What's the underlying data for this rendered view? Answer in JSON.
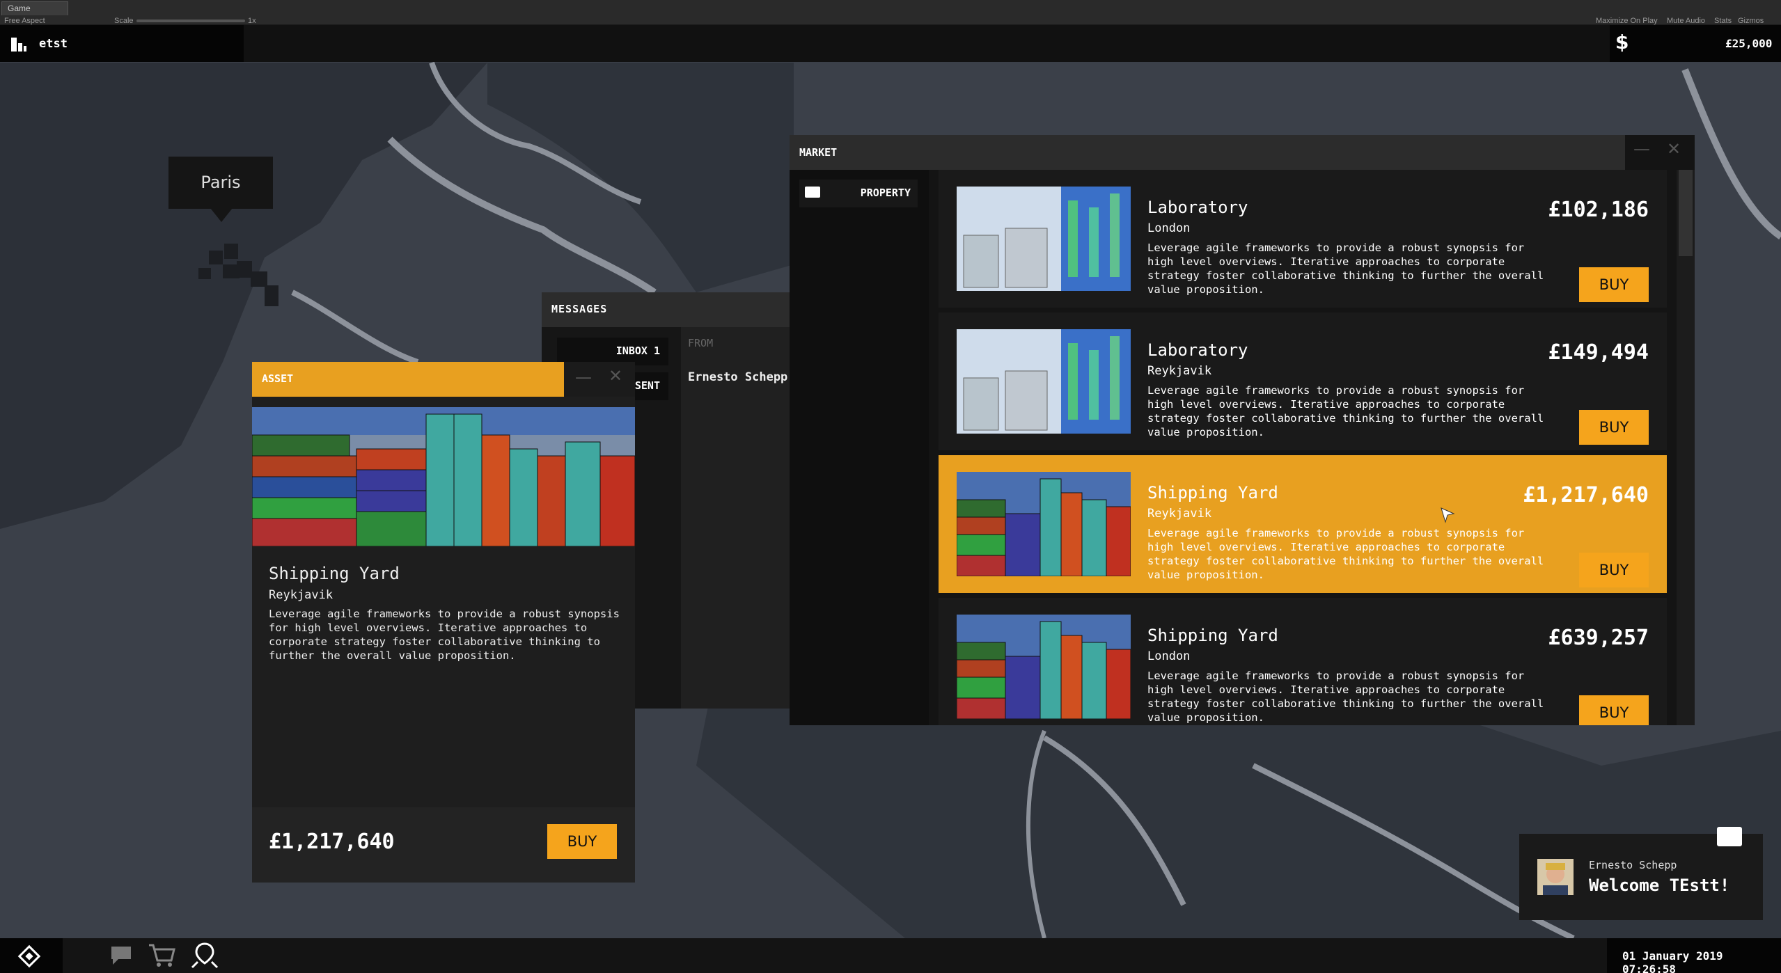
{
  "unity": {
    "tab": "Game",
    "aspect": "Free Aspect",
    "scale_label": "Scale",
    "scale_value": "1x",
    "options": [
      "Maximize On Play",
      "Mute Audio",
      "Stats",
      "Gizmos"
    ]
  },
  "topbar": {
    "company_icon": "building-icon",
    "company_name": "etst",
    "money_icon": "dollar-icon",
    "money": "£25,000"
  },
  "map": {
    "city_label": "Paris"
  },
  "messages": {
    "title": "MESSAGES",
    "inbox_label": "INBOX 1",
    "sent_label": "SENT",
    "from_header": "FROM",
    "rows": [
      {
        "from": "Ernesto Schepp"
      }
    ]
  },
  "asset": {
    "title": "ASSET",
    "name": "Shipping Yard",
    "location": "Reykjavik",
    "description": "Leverage agile frameworks to provide a robust synopsis for high level overviews. Iterative approaches to corporate strategy foster collaborative thinking to further the overall value proposition.",
    "price": "£1,217,640",
    "buy": "BUY"
  },
  "market": {
    "title": "MARKET",
    "tab": "PROPERTY",
    "items": [
      {
        "name": "Laboratory",
        "location": "London",
        "price": "£102,186",
        "description": "Leverage agile frameworks to provide a robust synopsis for high level overviews. Iterative approaches to corporate strategy foster collaborative thinking to further the overall value proposition.",
        "buy": "BUY",
        "image": "laboratory"
      },
      {
        "name": "Laboratory",
        "location": "Reykjavik",
        "price": "£149,494",
        "description": "Leverage agile frameworks to provide a robust synopsis for high level overviews. Iterative approaches to corporate strategy foster collaborative thinking to further the overall value proposition.",
        "buy": "BUY",
        "image": "laboratory"
      },
      {
        "name": "Shipping Yard",
        "location": "Reykjavik",
        "price": "£1,217,640",
        "description": "Leverage agile frameworks to provide a robust synopsis for high level overviews. Iterative approaches to corporate strategy foster collaborative thinking to further the overall value proposition.",
        "buy": "BUY",
        "image": "shipping-yard",
        "selected": true
      },
      {
        "name": "Shipping Yard",
        "location": "London",
        "price": "£639,257",
        "description": "Leverage agile frameworks to provide a robust synopsis for high level overviews. Iterative approaches to corporate strategy foster collaborative thinking to further the overall value proposition.",
        "buy": "BUY",
        "image": "shipping-yard"
      }
    ]
  },
  "notification": {
    "from": "Ernesto Schepp",
    "message": "Welcome TEstt!"
  },
  "bottombar": {
    "icons": [
      "logo-icon",
      "chat-icon",
      "cart-icon",
      "map-pin-icon"
    ],
    "datetime": "01 January 2019 07:26:58"
  },
  "colors": {
    "accent": "#e8a020",
    "buy": "#f5a41c",
    "panel": "#1a1a1a"
  }
}
